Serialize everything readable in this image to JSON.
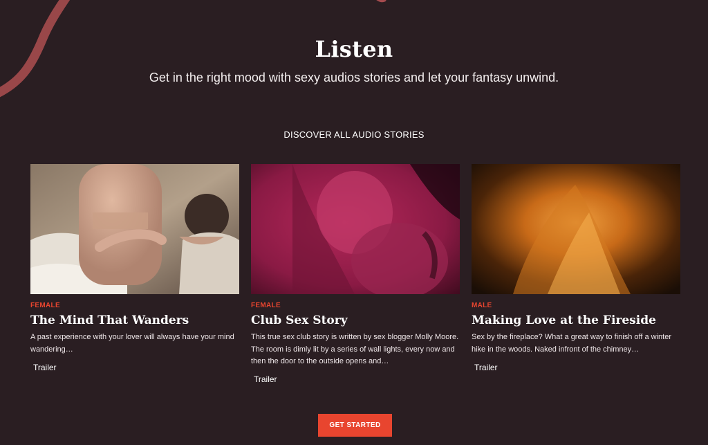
{
  "hero": {
    "title": "Listen",
    "subtitle": "Get in the right mood with sexy audios stories and let your fantasy unwind.",
    "discover_link": "DISCOVER ALL AUDIO STORIES"
  },
  "cards": [
    {
      "category": "FEMALE",
      "title": "The Mind That Wanders",
      "description": "A past experience with your lover will always have your mind wandering…",
      "trailer": "Trailer",
      "image": "couple-embrace-photo"
    },
    {
      "category": "FEMALE",
      "title": "Club Sex Story",
      "description": "This true sex club story is written by sex blogger Molly Moore. The room is dimly lit by a series of wall lights, every now and then the door to the outside opens and…",
      "trailer": "Trailer",
      "image": "magenta-kiss-photo"
    },
    {
      "category": "MALE",
      "title": "Making Love at the Fireside",
      "description": "Sex by the fireplace? What a great way to finish off a winter hike in the woods. Naked infront of the chimney…",
      "trailer": "Trailer",
      "image": "fireside-glow-photo"
    }
  ],
  "cta": {
    "label": "GET STARTED"
  },
  "colors": {
    "background": "#2a1e22",
    "accent": "#e8452f",
    "decoration": "#a54b4e"
  }
}
